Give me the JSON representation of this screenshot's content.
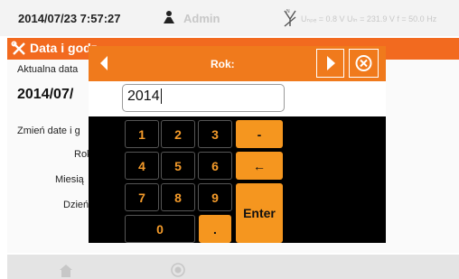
{
  "status_bar": {
    "datetime": "2014/07/23 7:57:27",
    "user": "Admin",
    "measurements": "Uₙₚₑ = 0.8 V Uₗₙ = 231.9 V f = 50.0 Hz"
  },
  "background": {
    "title": "Data i godz",
    "current_label": "Aktualna data",
    "current_value": "2014/07/",
    "change_label": "Zmień date i g",
    "year_label": "Rok",
    "month_label": "Miesią",
    "day_label": "Dzień"
  },
  "dialog": {
    "title": "Rok:",
    "input_value": "2014",
    "keys": [
      "1",
      "2",
      "3",
      "4",
      "5",
      "6",
      "7",
      "8",
      "9",
      "0"
    ],
    "minus": "-",
    "backspace": "←",
    "enter": "Enter",
    "dot": "."
  },
  "colors": {
    "accent": "#f07a1c",
    "key_text": "#f39a2a"
  }
}
